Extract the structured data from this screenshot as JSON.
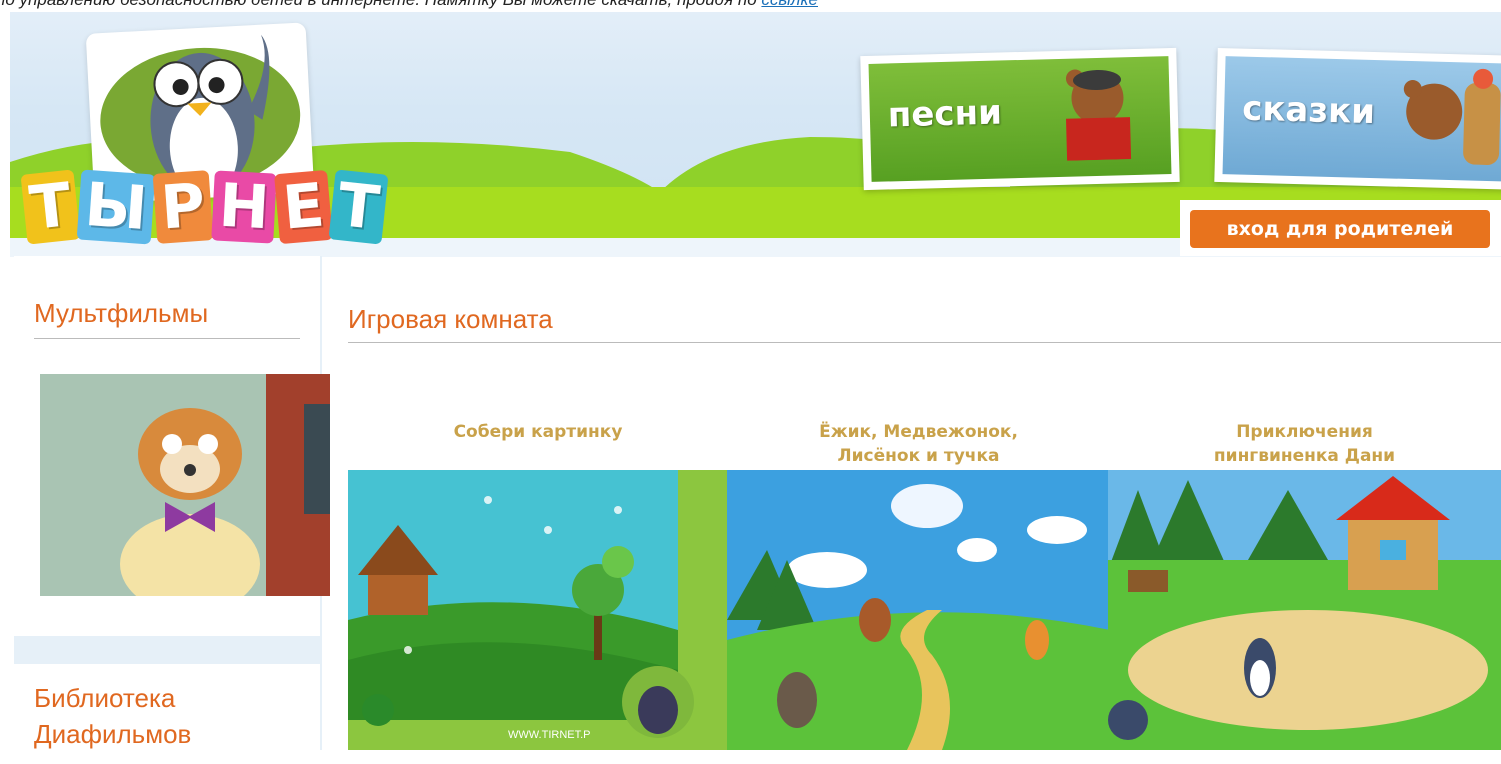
{
  "top_notice": {
    "text": "по управлению безопасностью детей в интернете. Памятку Вы можете скачать, пройдя по ",
    "link": "ссылке"
  },
  "header": {
    "logo_letters": [
      "Т",
      "Ы",
      "Р",
      "Н",
      "Е",
      "Т"
    ],
    "songs_label": "песни",
    "tales_label": "сказки",
    "parents_login": "вход для родителей"
  },
  "sidebar": {
    "cartoons_title": "Мультфильмы",
    "library_title_line1": "Библиотека",
    "library_title_line2": "Диафильмов"
  },
  "main": {
    "title": "Игровая комната",
    "games": [
      {
        "title_line1": "Собери картинку",
        "title_line2": "",
        "watermark": "WWW.TIRNET.P"
      },
      {
        "title_line1": "Ёжик, Медвежонок,",
        "title_line2": "Лисёнок и тучка"
      },
      {
        "title_line1": "Приключения",
        "title_line2": "пингвиненка Дани"
      }
    ]
  },
  "colors": {
    "accent_orange": "#e06820",
    "game_title": "#c9a24a",
    "header_green": "#a7dd1f",
    "sidebar_bg": "#e6f0f8"
  }
}
